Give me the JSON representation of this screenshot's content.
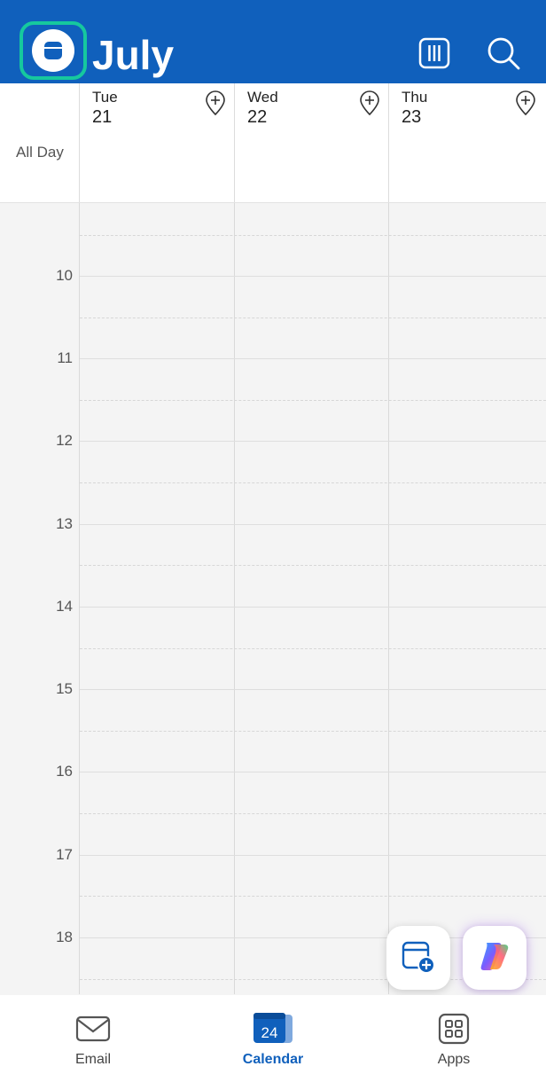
{
  "header": {
    "month": "July"
  },
  "allday_label": "All Day",
  "days": [
    {
      "name": "Tue",
      "date": "21"
    },
    {
      "name": "Wed",
      "date": "22"
    },
    {
      "name": "Thu",
      "date": "23"
    }
  ],
  "hours": [
    "10",
    "11",
    "12",
    "13",
    "14",
    "15",
    "16",
    "17",
    "18"
  ],
  "tabs": [
    {
      "label": "Email",
      "icon": "mail-icon"
    },
    {
      "label": "Calendar",
      "icon": "calendar-icon",
      "badge": "24",
      "active": true
    },
    {
      "label": "Apps",
      "icon": "apps-grid-icon"
    }
  ],
  "colors": {
    "accent": "#1060bc",
    "highlight": "#16c89e"
  }
}
